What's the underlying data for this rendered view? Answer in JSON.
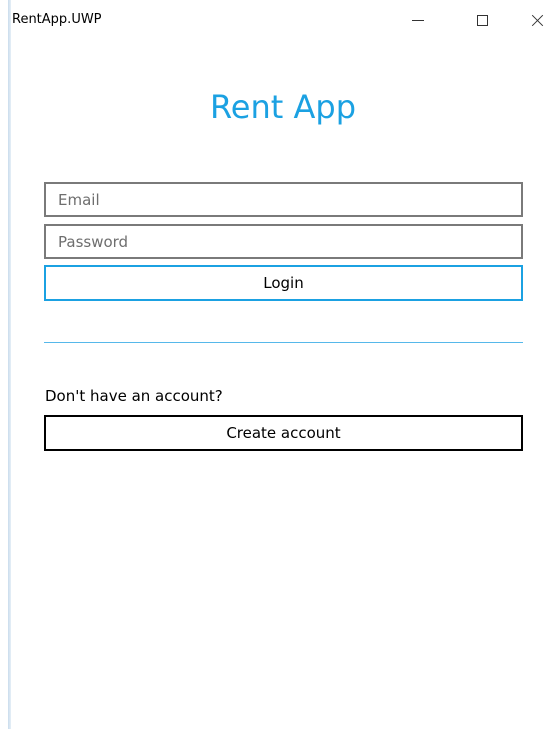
{
  "window": {
    "title": "RentApp.UWP",
    "controls": [
      "minimize-icon",
      "maximize-icon",
      "close-icon"
    ]
  },
  "main": {
    "heading": "Rent App",
    "email_placeholder": "Email",
    "email_value": "",
    "password_placeholder": "Password",
    "password_value": "",
    "login_label": "Login",
    "no_account_text": "Don't have an account?",
    "create_account_label": "Create account"
  },
  "colors": {
    "accent": "#1ba1e2",
    "field_border": "#7a7a7a",
    "background": "#ffffff"
  }
}
